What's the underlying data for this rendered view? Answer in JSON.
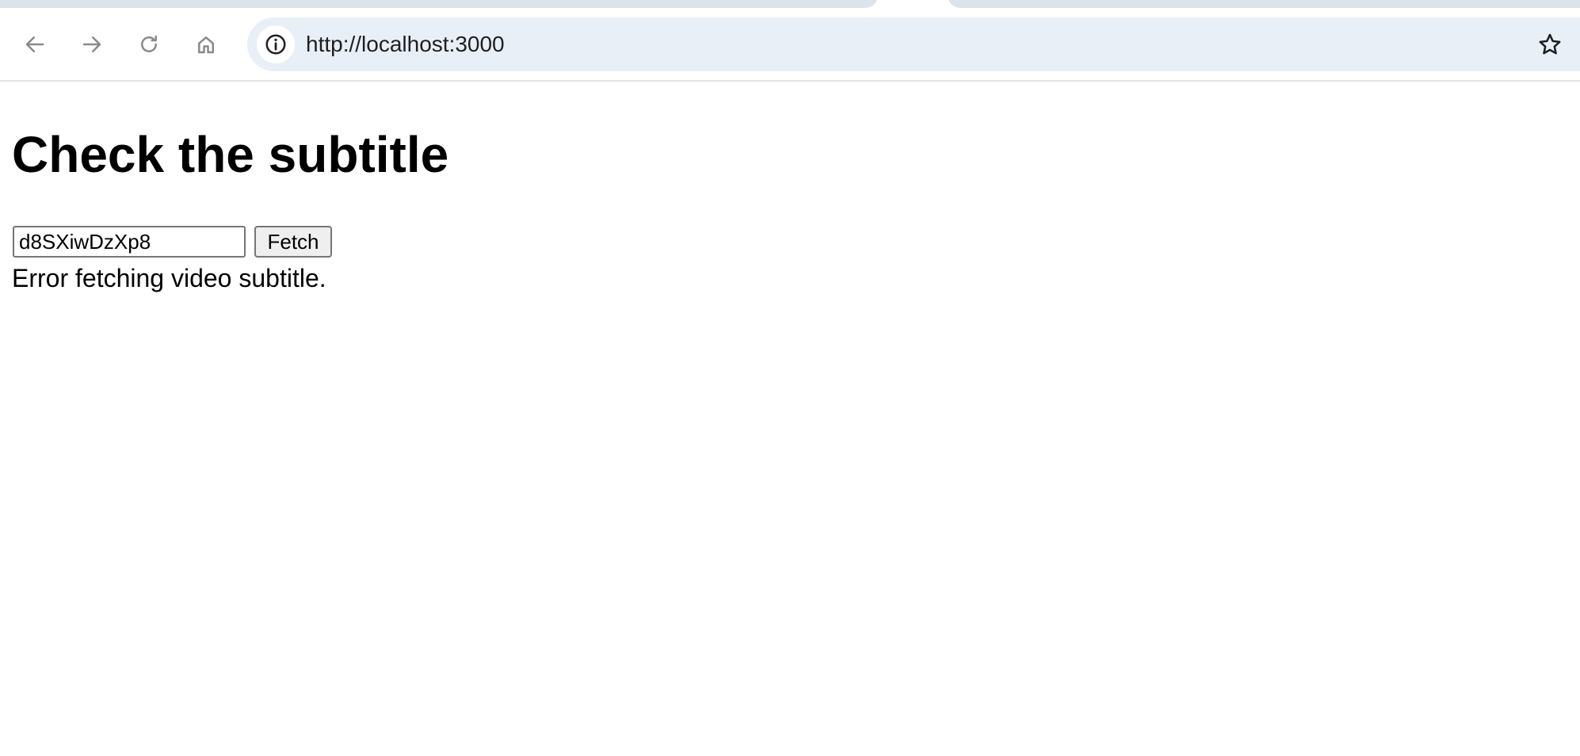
{
  "browser": {
    "url": "http://localhost:3000",
    "icons": {
      "back": "arrow-left-icon",
      "forward": "arrow-right-icon",
      "reload": "reload-icon",
      "home": "home-icon",
      "site_info": "info-icon",
      "bookmark": "star-icon"
    },
    "colors": {
      "omnibox_bg": "#e9eff7",
      "tab_strip": "#dde3ea",
      "icon_gray": "#8a8a8a"
    }
  },
  "page": {
    "title": "Check the subtitle",
    "video_input_value": "d8SXiwDzXp8",
    "fetch_button_label": "Fetch",
    "error_message": "Error fetching video subtitle."
  }
}
